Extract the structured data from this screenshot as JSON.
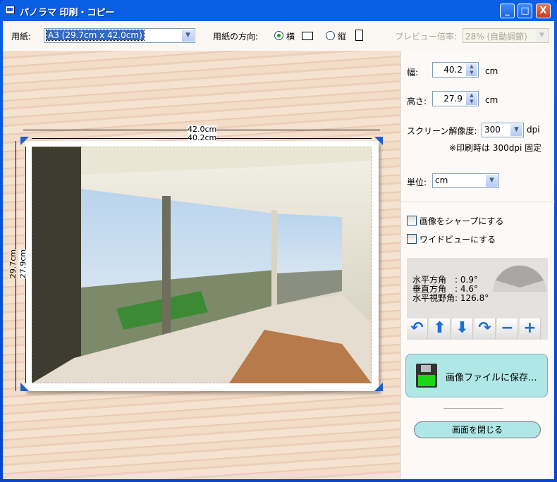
{
  "window": {
    "title": "パノラマ 印刷・コピー",
    "minimize": "_",
    "maximize": "□",
    "close": "X"
  },
  "toolbar": {
    "paper_label": "用紙:",
    "paper_value": "A3 (29.7cm x 42.0cm)",
    "orientation_label": "用紙の方向:",
    "landscape_label": "横",
    "portrait_label": "縦",
    "orientation_selected": "landscape",
    "preview_label": "プレビュー倍率:",
    "preview_value": "28% (自動調節)"
  },
  "preview": {
    "paper_width": "42.0cm",
    "image_width": "40.2cm",
    "paper_height": "29.7cm",
    "image_height": "27.9cm"
  },
  "side": {
    "width_label": "幅:",
    "width_value": "40.2",
    "width_unit": "cm",
    "height_label": "高さ:",
    "height_value": "27.9",
    "height_unit": "cm",
    "resolution_label": "スクリーン解像度:",
    "resolution_value": "300",
    "resolution_unit": "dpi",
    "print_note": "※印刷時は 300dpi 固定",
    "unit_label": "単位:",
    "unit_value": "cm",
    "sharpen_label": "画像をシャープにする",
    "sharpen_checked": false,
    "wide_label": "ワイドビューにする",
    "wide_checked": false,
    "angles": [
      {
        "label": "水平方角　:",
        "value": "0.9°"
      },
      {
        "label": "垂直方角　:",
        "value": "4.6°"
      },
      {
        "label": "水平視野角:",
        "value": "126.8°"
      }
    ],
    "save_label": "画像ファイルに保存...",
    "close_label": "画面を閉じる"
  }
}
